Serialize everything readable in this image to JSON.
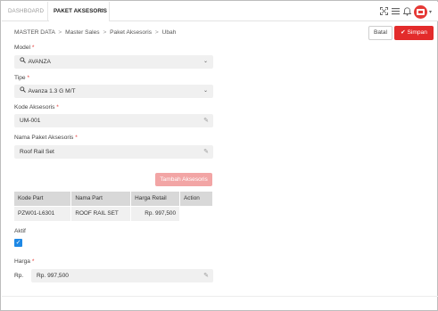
{
  "tabs": [
    {
      "label": "DASHBOARD"
    },
    {
      "label": "PAKET AKSESORIS",
      "close": "×"
    }
  ],
  "toolbar_icons": [
    "expand-icon",
    "menu-icon",
    "bell-icon",
    "avatar-icon"
  ],
  "breadcrumb": {
    "items": [
      "MASTER DATA",
      "Master Sales",
      "Paket Aksesoris",
      "Ubah"
    ],
    "sep": ">"
  },
  "actions": {
    "batal": "Batal",
    "simpan": "Simpan"
  },
  "form": {
    "model": {
      "label": "Model",
      "required": "*",
      "value": "AVANZA"
    },
    "tipe": {
      "label": "Tipe",
      "required": "*",
      "value": "Avanza 1.3 G M/T"
    },
    "kode": {
      "label": "Kode Aksesoris",
      "required": "*",
      "value": "UM-001"
    },
    "nama": {
      "label": "Nama Paket Aksesoris",
      "required": "*",
      "value": "Roof Rail Set"
    },
    "tambah_label": "Tambah Aksesoris",
    "aktif_label": "Aktif",
    "harga": {
      "label": "Harga",
      "required": "*",
      "prefix": "Rp.",
      "value": "Rp. 997,500"
    }
  },
  "table": {
    "headers": [
      "Kode Part",
      "Nama Part",
      "Harga Retail",
      "Action"
    ],
    "rows": [
      [
        "PZW01-L6301",
        "ROOF RAIL SET",
        "Rp. 997,500",
        ""
      ]
    ]
  },
  "colors": {
    "accent": "#e32b2b",
    "checkbox": "#1e88e5"
  }
}
